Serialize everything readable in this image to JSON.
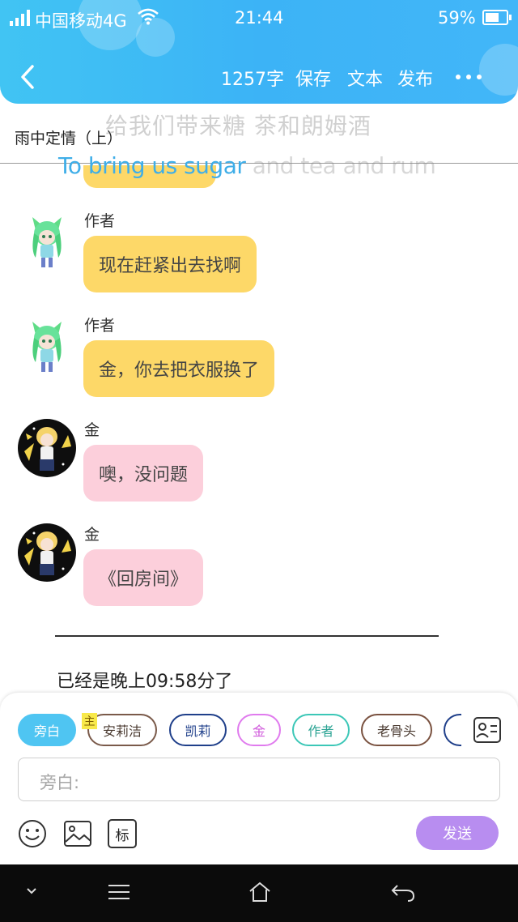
{
  "status_bar": {
    "carrier": "中国移动4G",
    "time": "21:44",
    "battery": "59%"
  },
  "header": {
    "word_count": "1257字",
    "save_label": "保存",
    "text_label": "文本",
    "publish_label": "发布"
  },
  "overlay": {
    "lyric_cn": "给我们带来糖 茶和朗姆酒",
    "lyric_en_highlight": "To bring us sugar",
    "lyric_en_rest": " and tea and rum"
  },
  "story_title": "雨中定情（上）",
  "messages": [
    {
      "speaker": "作者",
      "text": "现在赶紧出去找啊",
      "style": "yellow"
    },
    {
      "speaker": "作者",
      "text": "金，你去把衣服换了",
      "style": "yellow"
    },
    {
      "speaker": "金",
      "text": "噢，没问题",
      "style": "pink"
    },
    {
      "speaker": "金",
      "text": "《回房间》",
      "style": "pink"
    }
  ],
  "narration": "已经是晚上09:58分了",
  "composer": {
    "main_tag": "主",
    "chips": [
      {
        "label": "旁白",
        "color": "#4fc5f2",
        "active": true
      },
      {
        "label": "安莉洁",
        "color": "#7a5a4a",
        "active": false
      },
      {
        "label": "凯莉",
        "color": "#1f3f8a",
        "active": false
      },
      {
        "label": "金",
        "color": "#e07bee",
        "active": false
      },
      {
        "label": "作者",
        "color": "#3cc7b7",
        "active": false
      },
      {
        "label": "老骨头",
        "color": "#7a5240",
        "active": false
      }
    ],
    "input_placeholder": "旁白:",
    "send_label": "发送",
    "tool_tag_label": "标"
  },
  "colors": {
    "header": "#41b8f5",
    "yellow_bubble": "#fdd868",
    "pink_bubble": "#fccfdb",
    "send": "#b88df0"
  }
}
